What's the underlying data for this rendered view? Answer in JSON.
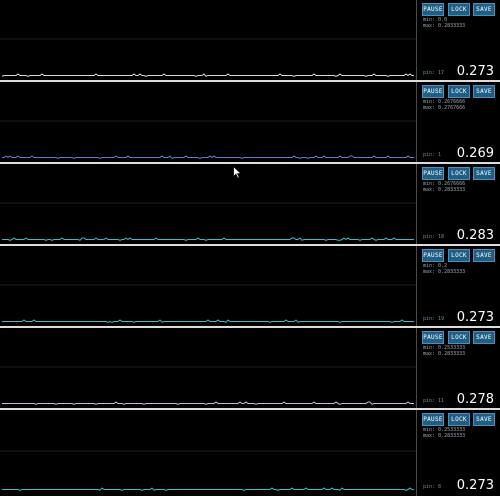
{
  "buttons": {
    "pause": "PAUSE",
    "lock": "LOCK",
    "save": "SAVE"
  },
  "colors": {
    "background": "#000000",
    "button": "#1f5f86",
    "separator": "#dcdcdc",
    "trace_1": "#d8d8d8",
    "trace_2": "#5a7fd6",
    "trace_3": "#40b8c8",
    "trace_4": "#40b8c8",
    "trace_5": "#c9b3e8",
    "trace_6": "#40b8c8"
  },
  "rows": [
    {
      "min": "min: 0.0",
      "max": "max: 0.2833333",
      "pin": "pin: 17",
      "value": "0.273",
      "level": 0.05
    },
    {
      "min": "min: 0.2676666",
      "max": "max: 0.2767666",
      "pin": "pin: 1",
      "value": "0.269",
      "level": 0.05
    },
    {
      "min": "min: 0.2676666",
      "max": "max: 0.2833333",
      "pin": "pin: 18",
      "value": "0.283",
      "level": 0.05
    },
    {
      "min": "min: 0.2",
      "max": "max: 0.2833333",
      "pin": "pin: 19",
      "value": "0.273",
      "level": 0.05
    },
    {
      "min": "min: 0.2533333",
      "max": "max: 0.2833333",
      "pin": "pin: 11",
      "value": "0.278",
      "level": 0.05
    },
    {
      "min": "min: 0.2533333",
      "max": "max: 0.2833333",
      "pin": "pin: 8",
      "value": "0.273",
      "level": 0.05
    }
  ]
}
